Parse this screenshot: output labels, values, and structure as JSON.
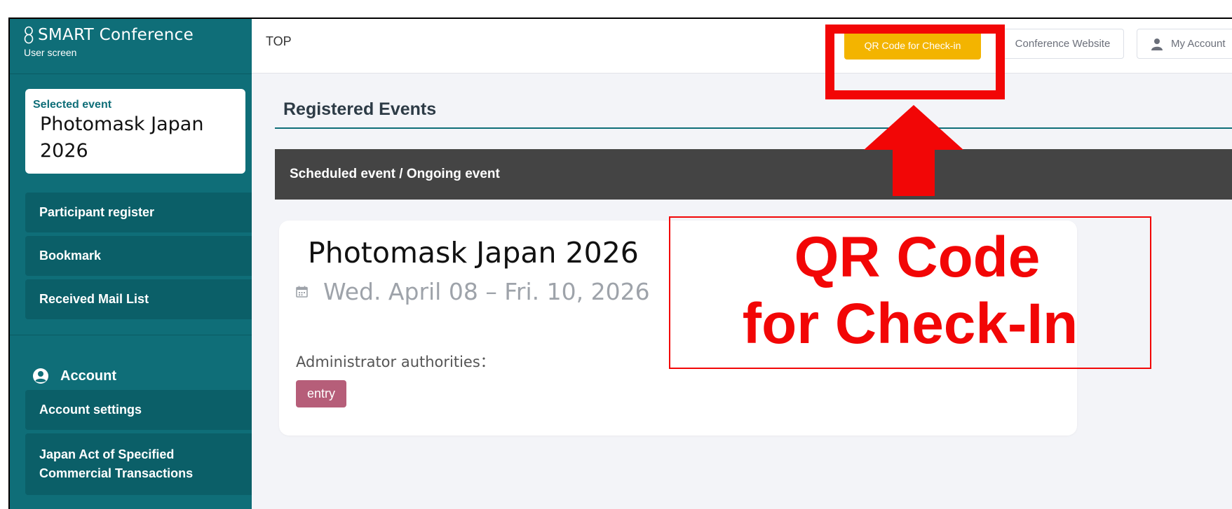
{
  "app": {
    "brand_name": "SMART Conference",
    "brand_sub": "User screen"
  },
  "header": {
    "breadcrumb": "TOP",
    "qr_button": "QR Code for Check-in",
    "website_button": "Conference Website",
    "account_button": "My Account"
  },
  "sidebar": {
    "selected_label": "Selected event",
    "selected_event": "Photomask Japan 2026",
    "items": [
      {
        "label": "Participant register"
      },
      {
        "label": "Bookmark"
      },
      {
        "label": "Received Mail List"
      }
    ],
    "account_heading": "Account",
    "account_items": [
      {
        "label": "Account settings"
      },
      {
        "label": "Japan Act of Specified Commercial Transactions"
      }
    ]
  },
  "main": {
    "section_title": "Registered Events",
    "bar_label": "Scheduled event / Ongoing event",
    "event": {
      "name": "Photomask Japan 2026",
      "date": "Wed. April 08 – Fri. 10, 2026",
      "admin_label": "Administrator authorities：",
      "badge": "entry"
    }
  },
  "annotation": {
    "line1": "QR Code",
    "line2": "for Check-In"
  },
  "colors": {
    "sidebar": "#0f6e78",
    "qr_button": "#f3b400",
    "badge": "#b65e79",
    "annotation": "#f20606"
  },
  "icons": {
    "brand": "infinity-icon",
    "calendar": "calendar-icon",
    "account": "user-circle-icon",
    "my_account": "person-icon"
  }
}
